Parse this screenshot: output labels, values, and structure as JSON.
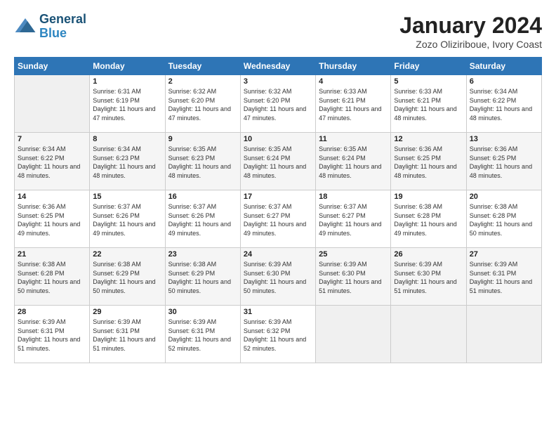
{
  "header": {
    "logo_line1": "General",
    "logo_line2": "Blue",
    "title": "January 2024",
    "subtitle": "Zozo Oliziriboue, Ivory Coast"
  },
  "days_of_week": [
    "Sunday",
    "Monday",
    "Tuesday",
    "Wednesday",
    "Thursday",
    "Friday",
    "Saturday"
  ],
  "weeks": [
    [
      {
        "day": "",
        "empty": true
      },
      {
        "day": "1",
        "sunrise": "Sunrise: 6:31 AM",
        "sunset": "Sunset: 6:19 PM",
        "daylight": "Daylight: 11 hours and 47 minutes."
      },
      {
        "day": "2",
        "sunrise": "Sunrise: 6:32 AM",
        "sunset": "Sunset: 6:20 PM",
        "daylight": "Daylight: 11 hours and 47 minutes."
      },
      {
        "day": "3",
        "sunrise": "Sunrise: 6:32 AM",
        "sunset": "Sunset: 6:20 PM",
        "daylight": "Daylight: 11 hours and 47 minutes."
      },
      {
        "day": "4",
        "sunrise": "Sunrise: 6:33 AM",
        "sunset": "Sunset: 6:21 PM",
        "daylight": "Daylight: 11 hours and 47 minutes."
      },
      {
        "day": "5",
        "sunrise": "Sunrise: 6:33 AM",
        "sunset": "Sunset: 6:21 PM",
        "daylight": "Daylight: 11 hours and 48 minutes."
      },
      {
        "day": "6",
        "sunrise": "Sunrise: 6:34 AM",
        "sunset": "Sunset: 6:22 PM",
        "daylight": "Daylight: 11 hours and 48 minutes."
      }
    ],
    [
      {
        "day": "7",
        "sunrise": "Sunrise: 6:34 AM",
        "sunset": "Sunset: 6:22 PM",
        "daylight": "Daylight: 11 hours and 48 minutes."
      },
      {
        "day": "8",
        "sunrise": "Sunrise: 6:34 AM",
        "sunset": "Sunset: 6:23 PM",
        "daylight": "Daylight: 11 hours and 48 minutes."
      },
      {
        "day": "9",
        "sunrise": "Sunrise: 6:35 AM",
        "sunset": "Sunset: 6:23 PM",
        "daylight": "Daylight: 11 hours and 48 minutes."
      },
      {
        "day": "10",
        "sunrise": "Sunrise: 6:35 AM",
        "sunset": "Sunset: 6:24 PM",
        "daylight": "Daylight: 11 hours and 48 minutes."
      },
      {
        "day": "11",
        "sunrise": "Sunrise: 6:35 AM",
        "sunset": "Sunset: 6:24 PM",
        "daylight": "Daylight: 11 hours and 48 minutes."
      },
      {
        "day": "12",
        "sunrise": "Sunrise: 6:36 AM",
        "sunset": "Sunset: 6:25 PM",
        "daylight": "Daylight: 11 hours and 48 minutes."
      },
      {
        "day": "13",
        "sunrise": "Sunrise: 6:36 AM",
        "sunset": "Sunset: 6:25 PM",
        "daylight": "Daylight: 11 hours and 48 minutes."
      }
    ],
    [
      {
        "day": "14",
        "sunrise": "Sunrise: 6:36 AM",
        "sunset": "Sunset: 6:25 PM",
        "daylight": "Daylight: 11 hours and 49 minutes."
      },
      {
        "day": "15",
        "sunrise": "Sunrise: 6:37 AM",
        "sunset": "Sunset: 6:26 PM",
        "daylight": "Daylight: 11 hours and 49 minutes."
      },
      {
        "day": "16",
        "sunrise": "Sunrise: 6:37 AM",
        "sunset": "Sunset: 6:26 PM",
        "daylight": "Daylight: 11 hours and 49 minutes."
      },
      {
        "day": "17",
        "sunrise": "Sunrise: 6:37 AM",
        "sunset": "Sunset: 6:27 PM",
        "daylight": "Daylight: 11 hours and 49 minutes."
      },
      {
        "day": "18",
        "sunrise": "Sunrise: 6:37 AM",
        "sunset": "Sunset: 6:27 PM",
        "daylight": "Daylight: 11 hours and 49 minutes."
      },
      {
        "day": "19",
        "sunrise": "Sunrise: 6:38 AM",
        "sunset": "Sunset: 6:28 PM",
        "daylight": "Daylight: 11 hours and 49 minutes."
      },
      {
        "day": "20",
        "sunrise": "Sunrise: 6:38 AM",
        "sunset": "Sunset: 6:28 PM",
        "daylight": "Daylight: 11 hours and 50 minutes."
      }
    ],
    [
      {
        "day": "21",
        "sunrise": "Sunrise: 6:38 AM",
        "sunset": "Sunset: 6:28 PM",
        "daylight": "Daylight: 11 hours and 50 minutes."
      },
      {
        "day": "22",
        "sunrise": "Sunrise: 6:38 AM",
        "sunset": "Sunset: 6:29 PM",
        "daylight": "Daylight: 11 hours and 50 minutes."
      },
      {
        "day": "23",
        "sunrise": "Sunrise: 6:38 AM",
        "sunset": "Sunset: 6:29 PM",
        "daylight": "Daylight: 11 hours and 50 minutes."
      },
      {
        "day": "24",
        "sunrise": "Sunrise: 6:39 AM",
        "sunset": "Sunset: 6:30 PM",
        "daylight": "Daylight: 11 hours and 50 minutes."
      },
      {
        "day": "25",
        "sunrise": "Sunrise: 6:39 AM",
        "sunset": "Sunset: 6:30 PM",
        "daylight": "Daylight: 11 hours and 51 minutes."
      },
      {
        "day": "26",
        "sunrise": "Sunrise: 6:39 AM",
        "sunset": "Sunset: 6:30 PM",
        "daylight": "Daylight: 11 hours and 51 minutes."
      },
      {
        "day": "27",
        "sunrise": "Sunrise: 6:39 AM",
        "sunset": "Sunset: 6:31 PM",
        "daylight": "Daylight: 11 hours and 51 minutes."
      }
    ],
    [
      {
        "day": "28",
        "sunrise": "Sunrise: 6:39 AM",
        "sunset": "Sunset: 6:31 PM",
        "daylight": "Daylight: 11 hours and 51 minutes."
      },
      {
        "day": "29",
        "sunrise": "Sunrise: 6:39 AM",
        "sunset": "Sunset: 6:31 PM",
        "daylight": "Daylight: 11 hours and 51 minutes."
      },
      {
        "day": "30",
        "sunrise": "Sunrise: 6:39 AM",
        "sunset": "Sunset: 6:31 PM",
        "daylight": "Daylight: 11 hours and 52 minutes."
      },
      {
        "day": "31",
        "sunrise": "Sunrise: 6:39 AM",
        "sunset": "Sunset: 6:32 PM",
        "daylight": "Daylight: 11 hours and 52 minutes."
      },
      {
        "day": "",
        "empty": true
      },
      {
        "day": "",
        "empty": true
      },
      {
        "day": "",
        "empty": true
      }
    ]
  ]
}
